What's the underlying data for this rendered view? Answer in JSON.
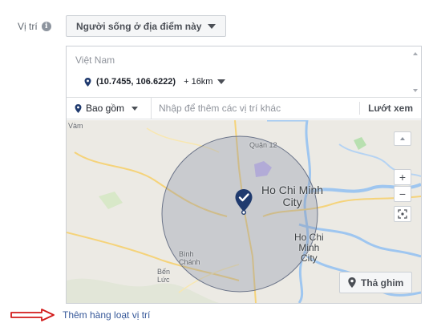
{
  "location_label": "Vị trí",
  "people_dropdown": {
    "label": "Người sống ở địa điểm này"
  },
  "location_list": {
    "country": "Việt Nam",
    "items": [
      {
        "coords": "(10.7455, 106.6222)",
        "radius": "+ 16km"
      }
    ]
  },
  "include_bar": {
    "include_label": "Bao gồm",
    "input_placeholder": "Nhập để thêm các vị trí khác",
    "browse_label": "Lướt xem"
  },
  "map": {
    "labels": {
      "district12": "Quận 12",
      "hcm_city": "Ho Chi Minh\nCity",
      "hcm_city2": "Ho Chi\nMinh\nCity",
      "binh_chanh": "Bình\nChánh",
      "ben_luc": "Bến\nLức",
      "vam": "Vàm"
    },
    "controls": {
      "zoom_in": "+",
      "zoom_out": "−"
    },
    "drop_pin_label": "Thả ghim",
    "colors": {
      "pin": "#1f3a6e",
      "circle": "#8a93a8"
    }
  },
  "bulk_add_link": "Thêm hàng loạt vị trí",
  "arrow_color": "#d21b1b"
}
